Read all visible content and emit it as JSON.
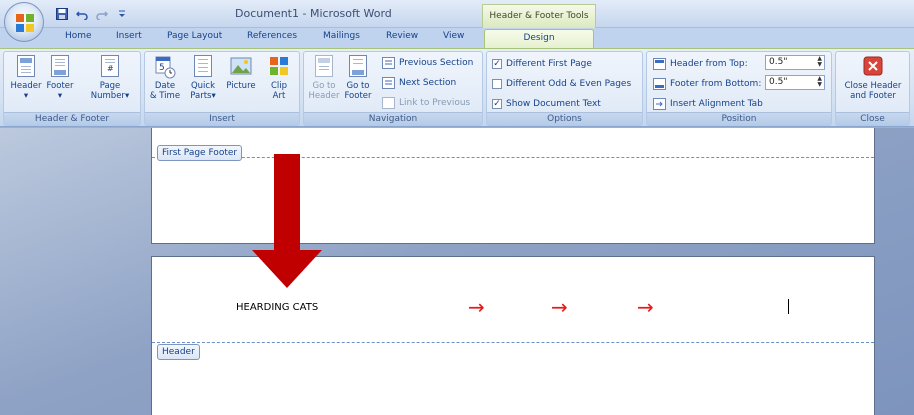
{
  "window": {
    "title": "Document1 - Microsoft Word",
    "context_tools": "Header & Footer Tools",
    "accent": "#a8c37a"
  },
  "quick_access": [
    "save-icon",
    "undo-icon",
    "redo-icon",
    "customize-icon"
  ],
  "tabs": [
    {
      "label": "Home"
    },
    {
      "label": "Insert"
    },
    {
      "label": "Page Layout"
    },
    {
      "label": "References"
    },
    {
      "label": "Mailings"
    },
    {
      "label": "Review"
    },
    {
      "label": "View"
    },
    {
      "label": "Design",
      "active": true
    }
  ],
  "ribbon": {
    "header_footer": {
      "label": "Header & Footer",
      "header": "Header",
      "footer": "Footer",
      "page_number_1": "Page",
      "page_number_2": "Number"
    },
    "insert": {
      "label": "Insert",
      "date_1": "Date",
      "date_2": "& Time",
      "quick_1": "Quick",
      "quick_2": "Parts",
      "picture": "Picture",
      "clip_1": "Clip",
      "clip_2": "Art"
    },
    "navigation": {
      "label": "Navigation",
      "goto_header_1": "Go to",
      "goto_header_2": "Header",
      "goto_footer_1": "Go to",
      "goto_footer_2": "Footer",
      "previous_section": "Previous Section",
      "next_section": "Next Section",
      "link_to_previous": "Link to Previous"
    },
    "options": {
      "label": "Options",
      "different_first_page": "Different First Page",
      "different_first_page_checked": true,
      "different_odd_even": "Different Odd & Even Pages",
      "different_odd_even_checked": false,
      "show_document_text": "Show Document Text",
      "show_document_text_checked": true
    },
    "position": {
      "label": "Position",
      "header_from_top": "Header from Top:",
      "header_from_top_value": "0.5\"",
      "footer_from_bottom": "Footer from Bottom:",
      "footer_from_bottom_value": "0.5\"",
      "insert_alignment_tab": "Insert Alignment Tab"
    },
    "close": {
      "label": "Close",
      "close_1": "Close Header",
      "close_2": "and Footer"
    }
  },
  "document": {
    "first_page_footer_label": "First Page Footer",
    "header_label": "Header",
    "header_text": "HEARDING CATS",
    "arrow_glyph": "→"
  }
}
